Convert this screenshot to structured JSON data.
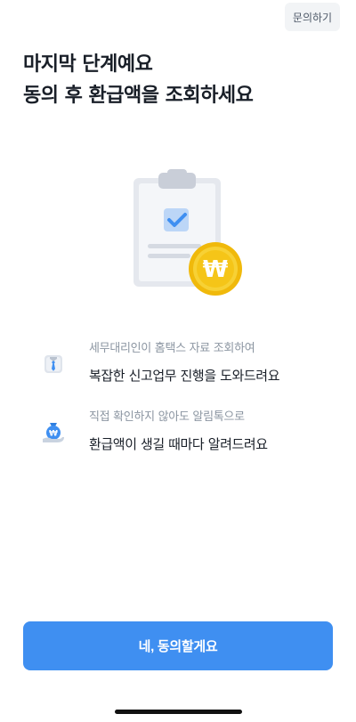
{
  "header": {
    "inquiry_label": "문의하기"
  },
  "title": {
    "line1": "마지막 단계예요",
    "line2": "동의 후 환급액을 조회하세요"
  },
  "illustration": {
    "icon": "clipboard-check-with-won-coin-icon",
    "coin_symbol": "₩"
  },
  "features": [
    {
      "icon": "tax-accountant-icon",
      "sub": "세무대리인이 홈택스 자료 조회하여",
      "main": "복잡한 신고업무 진행을 도와드려요"
    },
    {
      "icon": "money-bag-hand-icon",
      "sub": "직접 확인하지 않아도 알림톡으로",
      "main": "환급액이 생길 때마다 알려드려요"
    }
  ],
  "footer": {
    "agree_label": "네, 동의할게요"
  },
  "colors": {
    "primary": "#3f8ff1",
    "coin": "#f5c518",
    "text": "#191f28",
    "subtext": "#8b95a1"
  }
}
